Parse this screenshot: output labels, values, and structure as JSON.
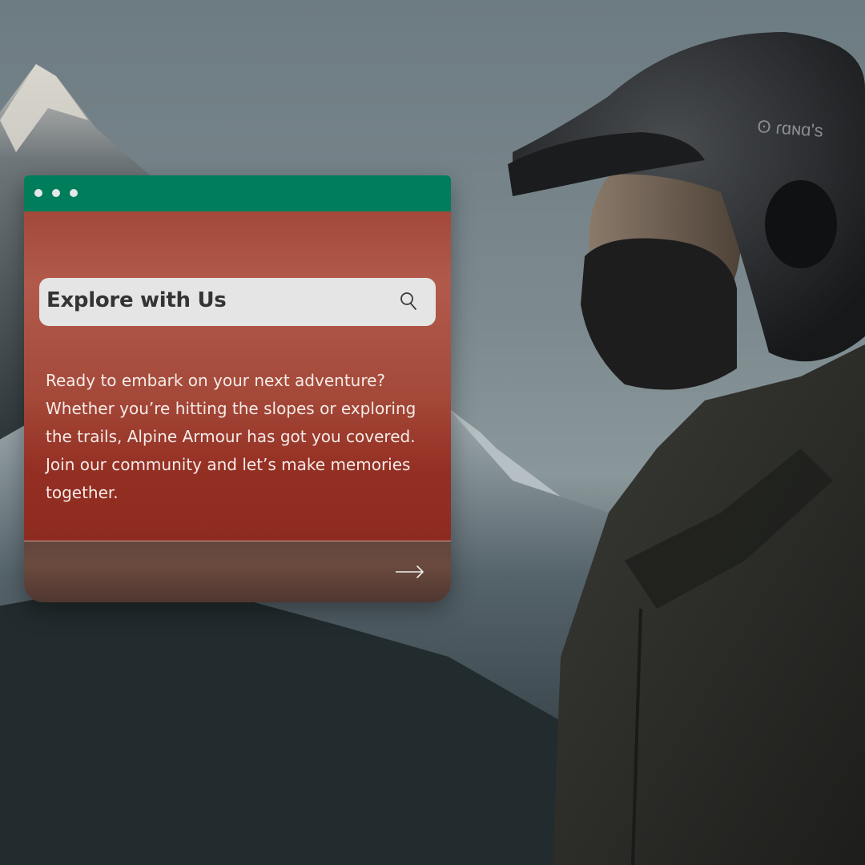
{
  "window": {
    "controls": [
      "dot",
      "dot",
      "dot"
    ]
  },
  "search": {
    "title": "Explore with Us",
    "icon": "search-icon"
  },
  "content": {
    "paragraph": "Ready to embark on your next adventure? Whether you’re hitting the slopes or exploring the trails, Alpine Armour has got you covered. Join our community and let’s make memories together."
  },
  "footer": {
    "icon": "arrow-right-icon"
  },
  "colors": {
    "titlebar": "#007d5b",
    "card_body": "#a44939",
    "footer": "#62463d",
    "search_bg": "#e5e5e5",
    "text_light": "#f5ebe8",
    "text_dark": "#343434"
  }
}
